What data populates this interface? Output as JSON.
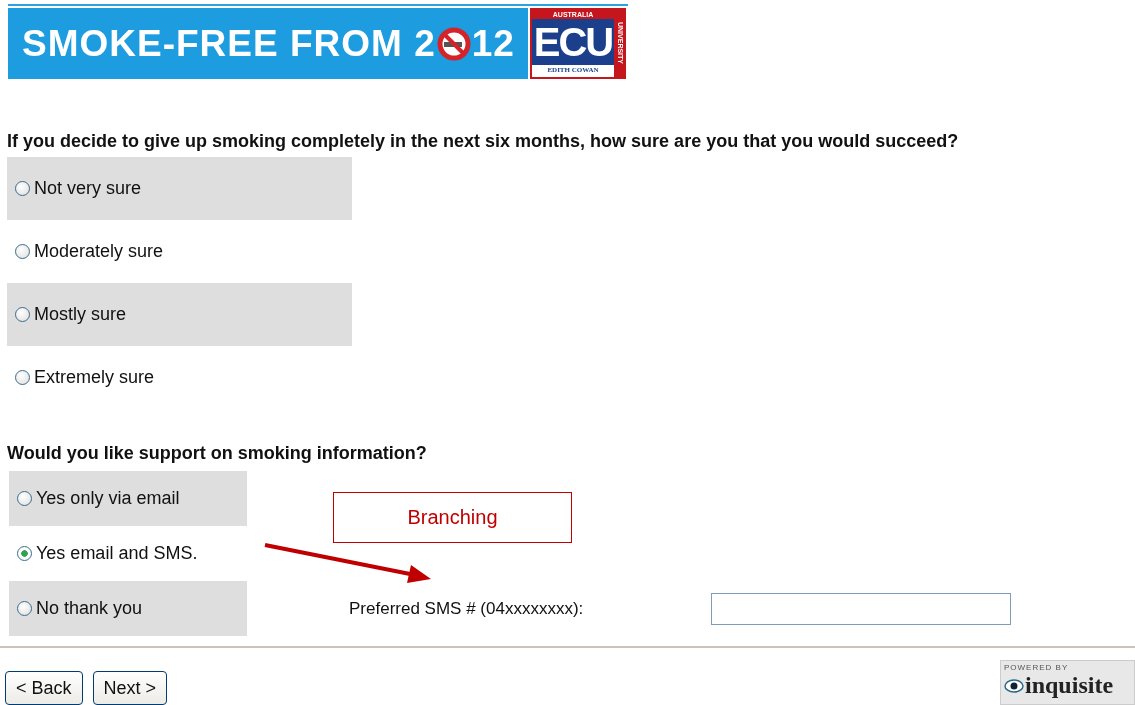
{
  "banner": {
    "title_start": "SMOKE-FREE FROM 2",
    "title_end": "12",
    "logo": {
      "top": "AUSTRALIA",
      "mark": "ECU",
      "bottom": "EDITH COWAN",
      "side": "UNIVERSITY"
    }
  },
  "questions": [
    {
      "text": "If you decide to give up smoking completely in the next six months, how sure are you that you would succeed?",
      "options": [
        {
          "label": "Not very sure",
          "selected": false
        },
        {
          "label": "Moderately sure",
          "selected": false
        },
        {
          "label": "Mostly sure",
          "selected": false
        },
        {
          "label": "Extremely sure",
          "selected": false
        }
      ]
    },
    {
      "text": "Would you like support on smoking information?",
      "options": [
        {
          "label": "Yes only via email",
          "selected": false
        },
        {
          "label": "Yes email and SMS.",
          "selected": true
        },
        {
          "label": "No thank you",
          "selected": false
        }
      ]
    }
  ],
  "annotation": {
    "label": "Branching"
  },
  "sms_field": {
    "label": "Preferred SMS # (04xxxxxxxx):"
  },
  "buttons": [
    "< Back",
    "Next >"
  ],
  "powered_by": {
    "top": "POWERED BY",
    "name": "inquisite"
  }
}
